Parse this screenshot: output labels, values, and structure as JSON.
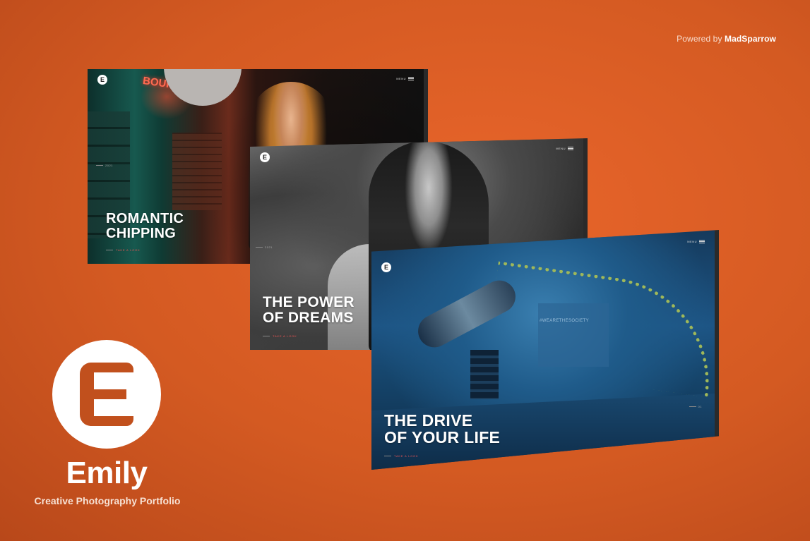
{
  "powered": {
    "prefix": "Powered by",
    "name": "MadSparrow"
  },
  "cards": [
    {
      "title_line1": "ROMANTIC",
      "title_line2": "CHIPPING",
      "logo_letter": "E",
      "menu_label": "MENU",
      "cta": "TAKE A LOOK",
      "side_num": "2021",
      "neon": "BOUR"
    },
    {
      "title_line1": "THE POWER",
      "title_line2": "OF DREAMS",
      "logo_letter": "E",
      "menu_label": "MENU",
      "cta": "TAKE A LOOK",
      "side_num": "2021"
    },
    {
      "title_line1": "THE DRIVE",
      "title_line2": "OF YOUR LIFE",
      "logo_letter": "E",
      "menu_label": "MENU",
      "cta": "TAKE A LOOK",
      "side_num": "01",
      "wall_text": "#WEARETHESOCIETY"
    }
  ],
  "brand": {
    "name": "Emily",
    "tagline": "Creative Photography Portfolio",
    "accent_color": "#c1501d"
  },
  "colors": {
    "background": "#e0602a"
  }
}
